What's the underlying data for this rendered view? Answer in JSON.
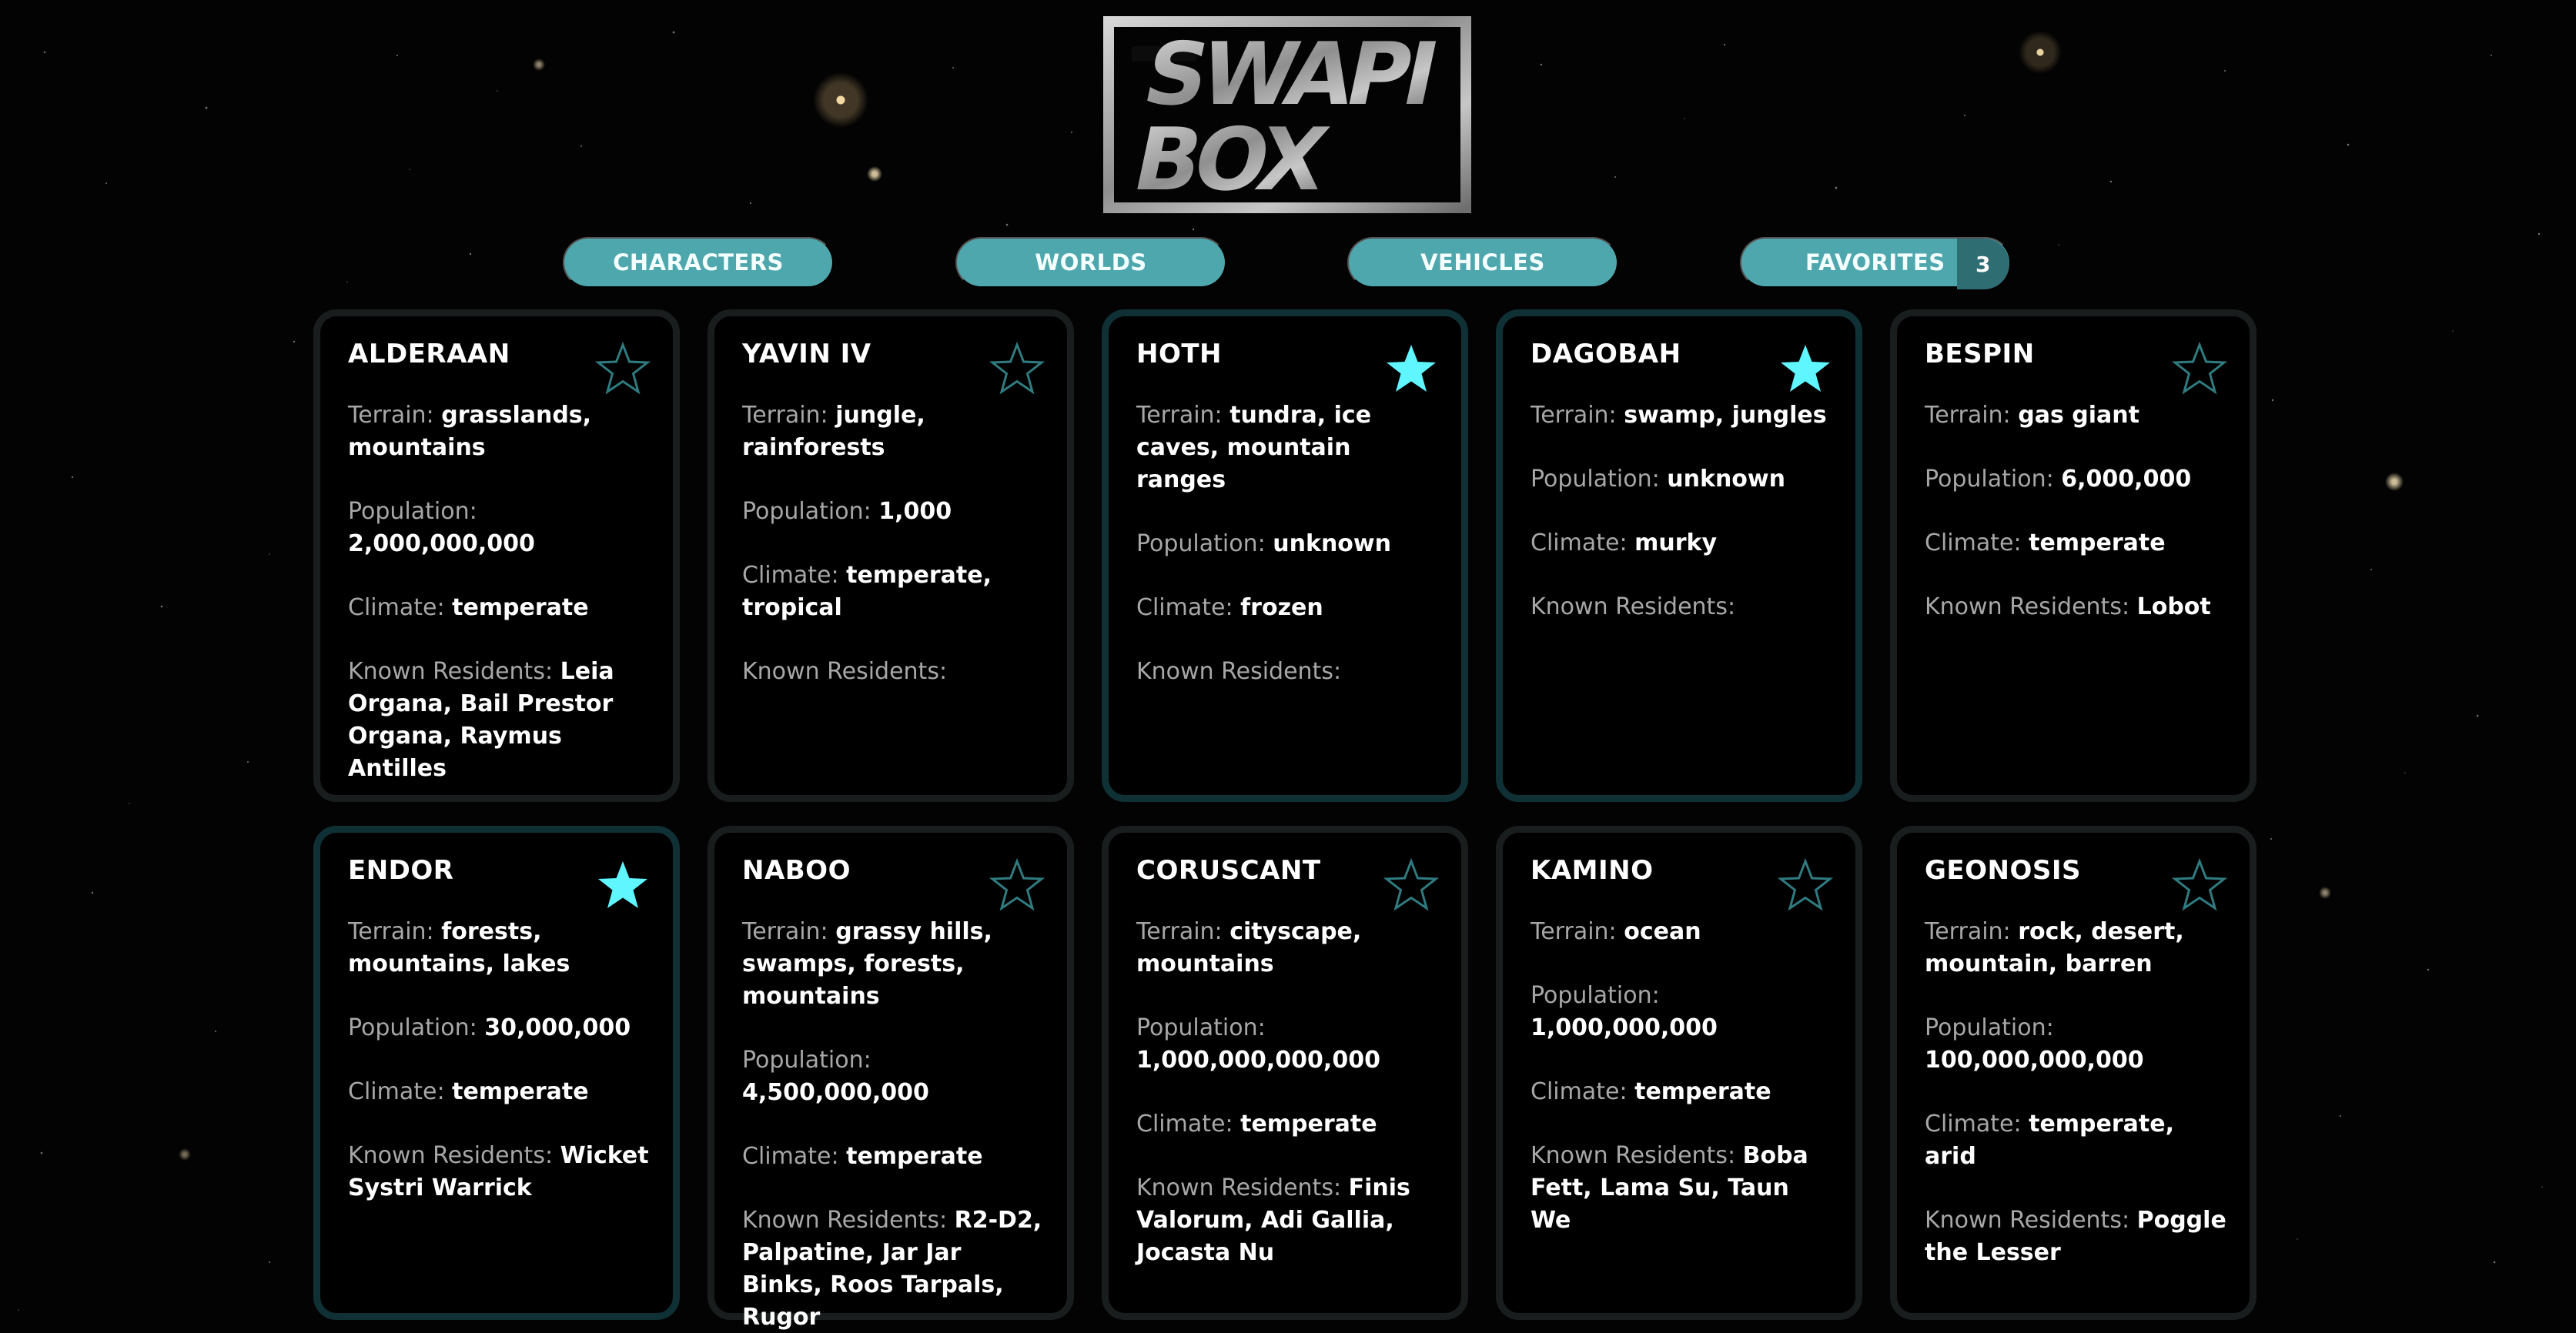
{
  "header": {
    "logo_line_1": "SWAPI",
    "logo_line_2": "BOX"
  },
  "nav": {
    "characters_label": "CHARACTERS",
    "worlds_label": "WORLDS",
    "vehicles_label": "VEHICLES",
    "favorites_label": "FAVORITES",
    "favorites_count": "3"
  },
  "labels": {
    "terrain": "Terrain:",
    "population": "Population:",
    "climate": "Climate:",
    "known_residents": "Known Residents:"
  },
  "cards": [
    {
      "name": "ALDERAAN",
      "favorite": false,
      "terrain": "grasslands, mountains",
      "population": "2,000,000,000",
      "climate": "temperate",
      "residents": "Leia Organa, Bail Prestor Organa, Raymus Antilles"
    },
    {
      "name": "YAVIN IV",
      "favorite": false,
      "terrain": "jungle, rainforests",
      "population": "1,000",
      "climate": "temperate, tropical",
      "residents": ""
    },
    {
      "name": "HOTH",
      "favorite": true,
      "terrain": "tundra, ice caves, mountain ranges",
      "population": "unknown",
      "climate": "frozen",
      "residents": ""
    },
    {
      "name": "DAGOBAH",
      "favorite": true,
      "terrain": "swamp, jungles",
      "population": "unknown",
      "climate": "murky",
      "residents": ""
    },
    {
      "name": "BESPIN",
      "favorite": false,
      "terrain": "gas giant",
      "population": "6,000,000",
      "climate": "temperate",
      "residents": "Lobot"
    },
    {
      "name": "ENDOR",
      "favorite": true,
      "terrain": "forests, mountains, lakes",
      "population": "30,000,000",
      "climate": "temperate",
      "residents": "Wicket Systri Warrick"
    },
    {
      "name": "NABOO",
      "favorite": false,
      "terrain": "grassy hills, swamps, forests, mountains",
      "population": "4,500,000,000",
      "climate": "temperate",
      "residents": "R2-D2, Palpatine, Jar Jar Binks, Roos Tarpals, Rugor"
    },
    {
      "name": "CORUSCANT",
      "favorite": false,
      "terrain": "cityscape, mountains",
      "population": "1,000,000,000,000",
      "climate": "temperate",
      "residents": "Finis Valorum, Adi Gallia, Jocasta Nu"
    },
    {
      "name": "KAMINO",
      "favorite": false,
      "terrain": "ocean",
      "population": "1,000,000,000",
      "climate": "temperate",
      "residents": "Boba Fett, Lama Su, Taun We"
    },
    {
      "name": "GEONOSIS",
      "favorite": false,
      "terrain": "rock, desert, mountain, barren",
      "population": "100,000,000,000",
      "climate": "temperate, arid",
      "residents": "Poggle the Lesser"
    }
  ],
  "colors": {
    "nav_button": "#4ea7ad",
    "nav_count": "#2e6e73",
    "favorite_star": "#5ff6ff",
    "empty_star": "#2f7b80",
    "card_border": "#191d1d",
    "card_border_favorite": "#0f3136"
  },
  "icons": {
    "favorite_star": "filled-star-icon",
    "unfavorite_star": "outline-star-icon"
  }
}
